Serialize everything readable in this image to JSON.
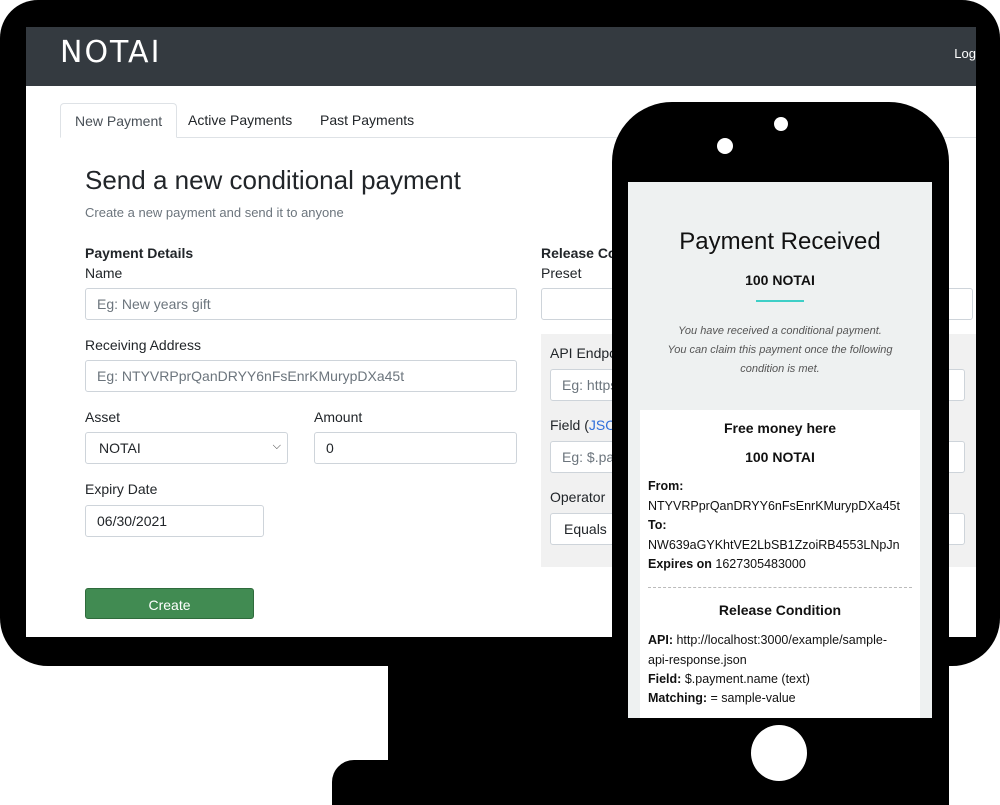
{
  "app": {
    "brand": "NOTAI",
    "login_label": "Log"
  },
  "tabs": [
    {
      "label": "New Payment",
      "active": true
    },
    {
      "label": "Active Payments",
      "active": false
    },
    {
      "label": "Past Payments",
      "active": false
    }
  ],
  "form": {
    "title": "Send a new conditional payment",
    "subtitle": "Create a new payment and send it to anyone",
    "payment_details_heading": "Payment Details",
    "name_label": "Name",
    "name_placeholder": "Eg: New years gift",
    "receiving_address_label": "Receiving Address",
    "receiving_address_placeholder": "Eg: NTYVRPprQanDRYY6nFsEnrKMurypDXa45t",
    "asset_label": "Asset",
    "asset_value": "NOTAI",
    "amount_label": "Amount",
    "amount_value": "0",
    "expiry_label": "Expiry Date",
    "expiry_value": "06/30/2021",
    "create_button": "Create"
  },
  "release": {
    "heading": "Release Co",
    "preset_label": "Preset",
    "preset_value": "",
    "api_label": "API Endpo",
    "api_placeholder": "Eg: https",
    "field_label_prefix": "Field (",
    "field_label_link": "JSO",
    "field_placeholder": "Eg: $.pa",
    "operator_label": "Operator",
    "operator_value": "Equals"
  },
  "phone": {
    "title": "Payment Received",
    "amount": "100 NOTAI",
    "message_line1": "You have received a conditional payment.",
    "message_line2": "You can claim this payment once the following",
    "message_line3": "condition is met.",
    "card": {
      "title": "Free money here",
      "amount": "100 NOTAI",
      "from_label": "From:",
      "from_value": "NTYVRPprQanDRYY6nFsEnrKMurypDXa45t",
      "to_label": "To:",
      "to_value": "NW639aGYKhtVE2LbSB1ZzoiRB4553LNpJn",
      "expires_label": "Expires on",
      "expires_value": "1627305483000",
      "release_title": "Release Condition",
      "api_label": "API:",
      "api_value_line1": "http://localhost:3000/example/sample-",
      "api_value_line2": "api-response.json",
      "field_label": "Field:",
      "field_value": "$.payment.name (text)",
      "matching_label": "Matching:",
      "matching_value": "= sample-value"
    }
  },
  "colors": {
    "navbar": "#343a40",
    "create_button": "#418b52",
    "accent_rule": "#3ecfc7",
    "link": "#2f6fdb"
  }
}
